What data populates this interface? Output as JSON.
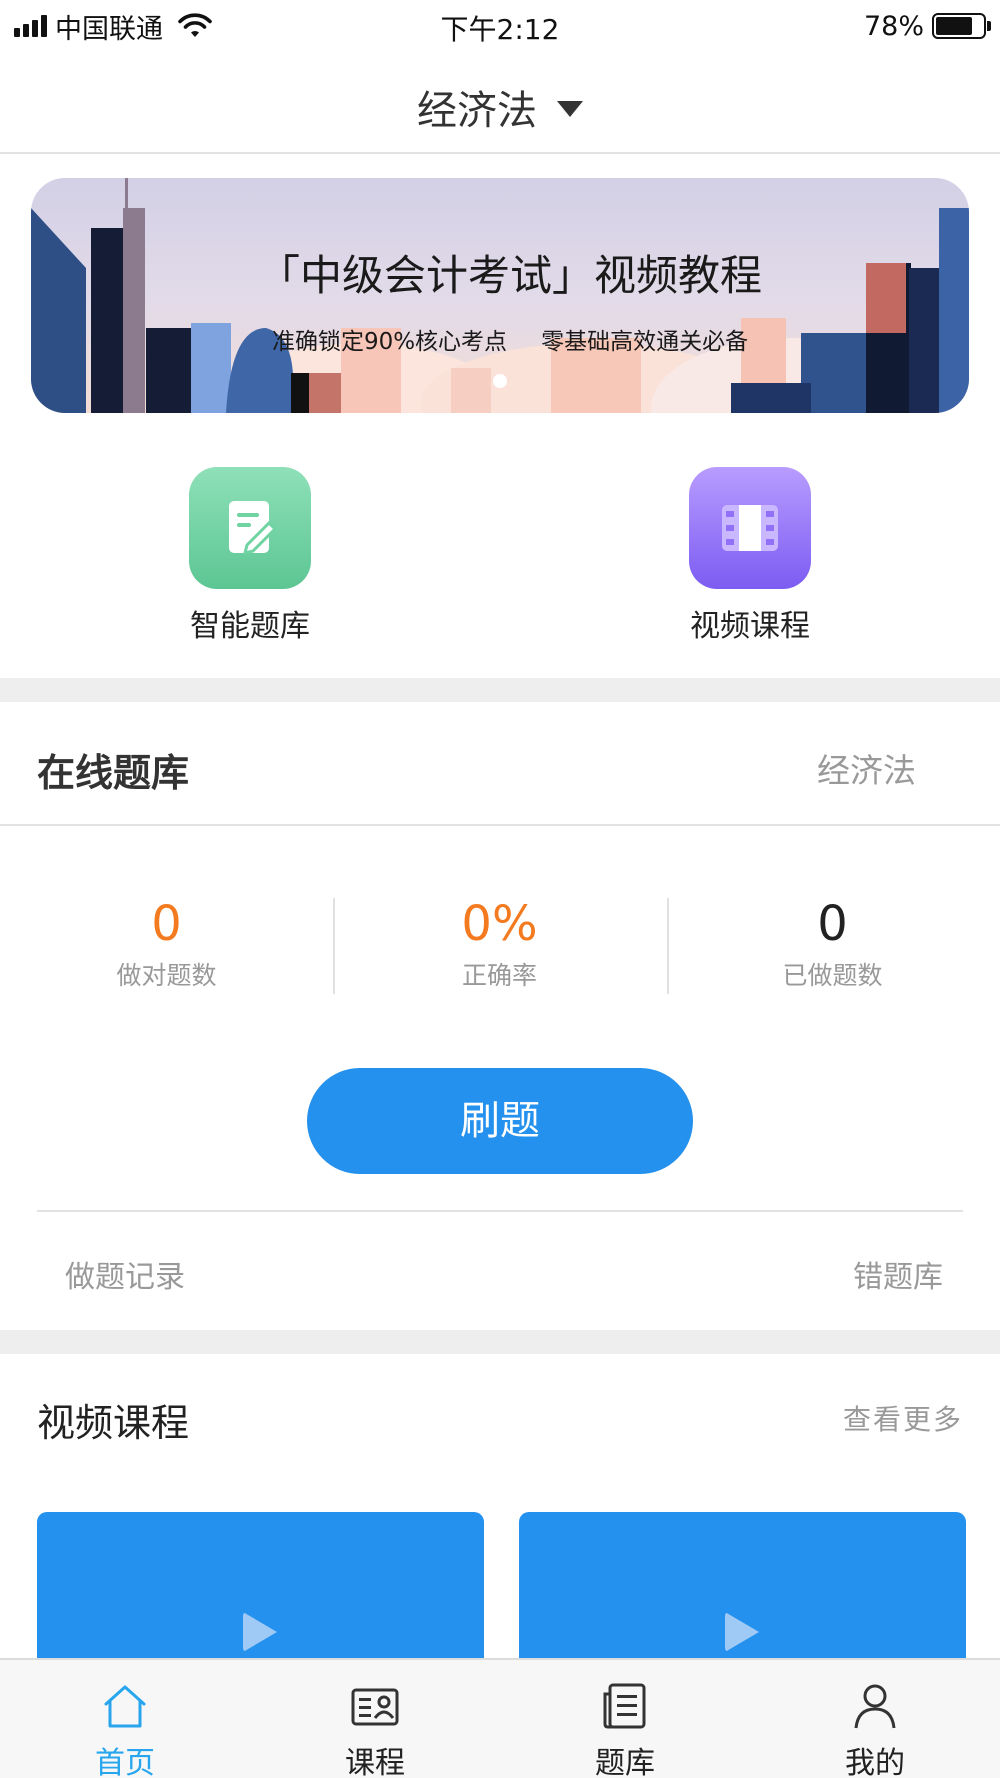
{
  "status_bar": {
    "carrier": "中国联通",
    "time": "下午2:12",
    "battery_percent": "78%",
    "battery_level": 0.78
  },
  "nav": {
    "title": "经济法"
  },
  "banner": {
    "title": "「中级会计考试」视频教程",
    "subtitle_1": "准确锁定90%核心考点",
    "subtitle_2": "零基础高效通关必备"
  },
  "quick_entries": [
    {
      "label": "智能题库",
      "icon": "note-edit-icon",
      "color": "#6fd3a2"
    },
    {
      "label": "视频课程",
      "icon": "film-icon",
      "color": "#9270f7"
    }
  ],
  "online_bank": {
    "title": "在线题库",
    "subject": "经济法",
    "stats": [
      {
        "value": "0",
        "label": "做对题数",
        "color": "#f47a1f"
      },
      {
        "value": "0%",
        "label": "正确率",
        "color": "#f47a1f"
      },
      {
        "value": "0",
        "label": "已做题数",
        "color": "#222222"
      }
    ],
    "practice_button": "刷题",
    "record_link": "做题记录",
    "wrong_link": "错题库"
  },
  "video_section": {
    "title": "视频课程",
    "more": "查看更多"
  },
  "tabbar": {
    "items": [
      {
        "label": "首页",
        "icon": "home-icon",
        "active": true
      },
      {
        "label": "课程",
        "icon": "course-card-icon",
        "active": false
      },
      {
        "label": "题库",
        "icon": "question-list-icon",
        "active": false
      },
      {
        "label": "我的",
        "icon": "user-icon",
        "active": false
      }
    ],
    "active_color": "#27a6ee"
  },
  "colors": {
    "accent": "#2591ee",
    "orange": "#f47a1f"
  }
}
